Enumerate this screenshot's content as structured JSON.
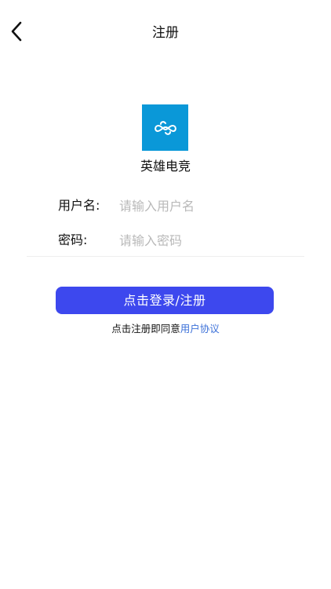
{
  "nav": {
    "title": "注册",
    "back_icon": "chevron-left-icon"
  },
  "app": {
    "name": "英雄电竞",
    "logo_color": "#0a98d8",
    "logo_icon": "link-infinity-icon"
  },
  "form": {
    "username_label": "用户名:",
    "username_placeholder": "请输入用户名",
    "username_value": "",
    "password_label": "密码:",
    "password_placeholder": "请输入密码",
    "password_value": ""
  },
  "submit": {
    "label": "点击登录/注册",
    "color": "#3d48ee"
  },
  "agreement": {
    "prefix": "点击注册即同意",
    "link_text": "用户协议",
    "link_color": "#3a6fd8"
  }
}
